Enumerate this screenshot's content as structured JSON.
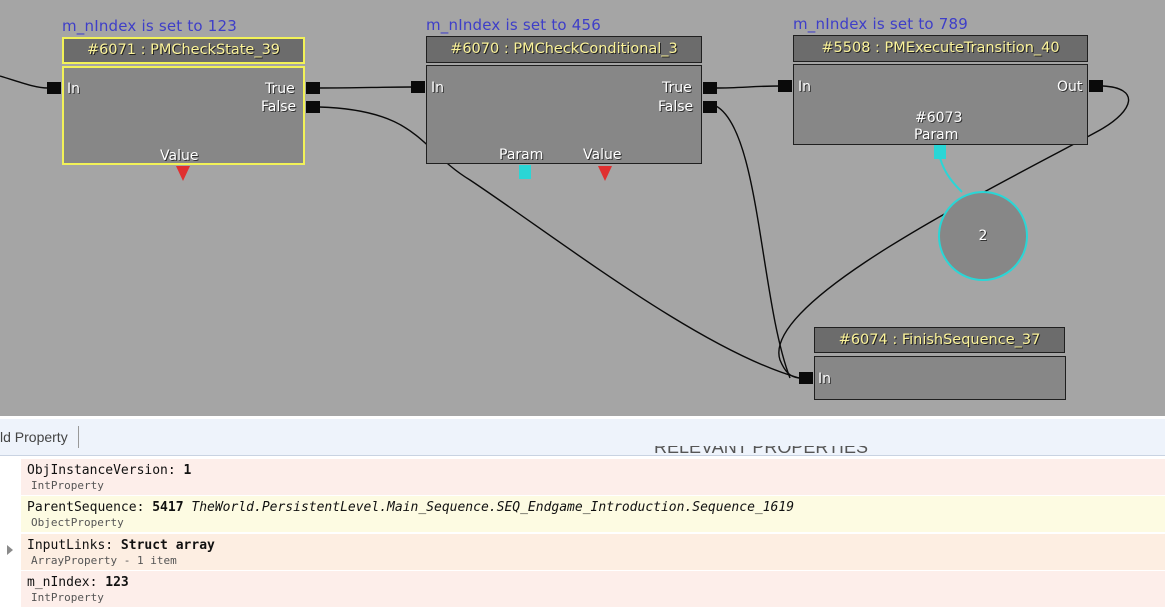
{
  "graph": {
    "comments": {
      "c1": "m_nIndex is set to 123",
      "c2": "m_nIndex is set to 456",
      "c3": "m_nIndex is set to 789"
    },
    "nodes": {
      "check_state": {
        "title": "#6071 : PMCheckState_39",
        "in": "In",
        "true": "True",
        "false": "False",
        "value": "Value"
      },
      "check_conditional": {
        "title": "#6070 : PMCheckConditional_3",
        "in": "In",
        "true": "True",
        "false": "False",
        "param": "Param",
        "value": "Value"
      },
      "execute_transition": {
        "title": "#5508 : PMExecuteTransition_40",
        "in": "In",
        "out": "Out",
        "var_id": "#6073",
        "param": "Param"
      },
      "finish_sequence": {
        "title": "#6074 : FinishSequence_37",
        "in": "In"
      }
    },
    "variable": {
      "value": "2"
    },
    "colors": {
      "canvas": "#a5a5a5",
      "selection": "#f2f258",
      "variable_port": "#2ad6d6",
      "output_marker": "#e03030"
    }
  },
  "panel": {
    "header": "ld Property",
    "ghost_text": "RELEVANT PROPERTIES",
    "rows": [
      {
        "name": "ObjInstanceVersion:",
        "value": "1",
        "extra": "",
        "type": "IntProperty",
        "bg": "#fdeeea"
      },
      {
        "name": "ParentSequence:",
        "value": "5417",
        "extra": "TheWorld.PersistentLevel.Main_Sequence.SEQ_Endgame_Introduction.Sequence_1619",
        "type": "ObjectProperty",
        "bg": "#fdfbe2"
      },
      {
        "name": "InputLinks:",
        "value": "Struct array",
        "extra": "",
        "type": "ArrayProperty - 1 item",
        "bg": "#fdeee2"
      },
      {
        "name": "m_nIndex:",
        "value": "123",
        "extra": "",
        "type": "IntProperty",
        "bg": "#fdeeea"
      }
    ]
  }
}
